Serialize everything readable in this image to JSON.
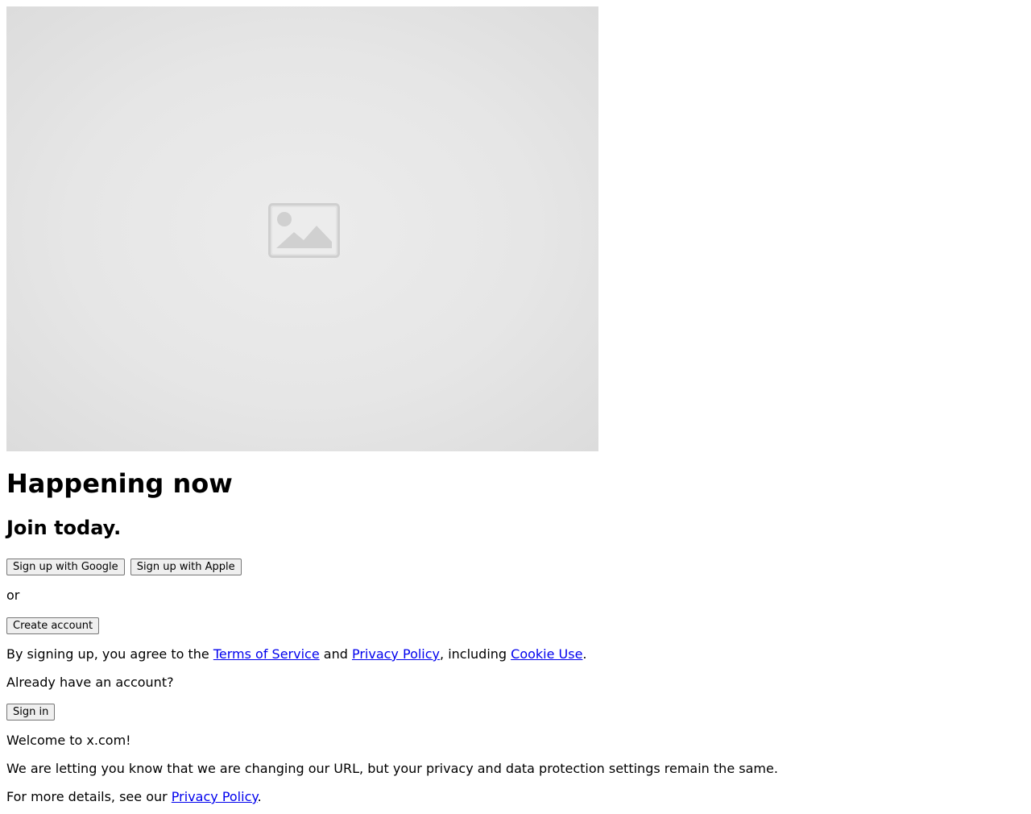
{
  "hero": {
    "image_icon": "image-placeholder-icon"
  },
  "heading": {
    "title": "Happening now",
    "subtitle": "Join today."
  },
  "signup": {
    "google_label": "Sign up with Google",
    "apple_label": "Sign up with Apple",
    "or_text": "or",
    "create_account_label": "Create account"
  },
  "terms": {
    "prefix": "By signing up, you agree to the ",
    "terms_link": "Terms of Service",
    "and_text": " and ",
    "privacy_link": "Privacy Policy",
    "including_text": ", including ",
    "cookie_link": "Cookie Use",
    "suffix": "."
  },
  "signin": {
    "prompt": "Already have an account?",
    "button_label": "Sign in"
  },
  "notice": {
    "welcome": "Welcome to x.com!",
    "url_change": "We are letting you know that we are changing our URL, but your privacy and data protection settings remain the same.",
    "details_prefix": "For more details, see our ",
    "details_link": "Privacy Policy",
    "details_suffix": "."
  }
}
